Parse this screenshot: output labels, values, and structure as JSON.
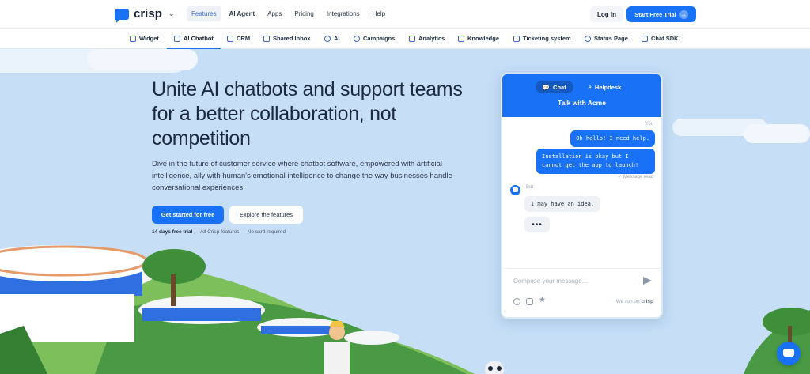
{
  "header": {
    "logo_text": "crisp",
    "nav": [
      "Features",
      "AI Agent",
      "Apps",
      "Pricing",
      "Integrations",
      "Help"
    ],
    "login": "Log In",
    "trial": "Start Free Trial"
  },
  "subnav": [
    "Widget",
    "AI Chatbot",
    "CRM",
    "Shared Inbox",
    "AI",
    "Campaigns",
    "Analytics",
    "Knowledge",
    "Ticketing system",
    "Status Page",
    "Chat SDK"
  ],
  "hero": {
    "title": "Unite AI chatbots and support teams for a better collaboration, not competition",
    "description": "Dive in the future of customer service where chatbot software, empowered with artificial intelligence, ally with human's emotional intelligence to change the way businesses handle conversational experiences.",
    "cta_primary": "Get started for free",
    "cta_secondary": "Explore the features",
    "trial_bold": "14 days free trial",
    "trial_rest": " — All Crisp features — No card required"
  },
  "chat": {
    "tab_chat": "Chat",
    "tab_helpdesk": "Helpdesk",
    "title": "Talk with Acme",
    "you_label": "You",
    "msg1": "Oh hello! I need help.",
    "msg2": "Installation is okay but I cannot get the app to launch!",
    "read": "✓ Message read",
    "bot_label": "Bot",
    "bot_msg": "I may have an idea.",
    "typing": "•••",
    "compose_placeholder": "Compose your message...",
    "run_on": "We run on",
    "run_on_brand": "crisp"
  },
  "colors": {
    "accent": "#1972f5",
    "hero_bg": "#c6dff7"
  }
}
